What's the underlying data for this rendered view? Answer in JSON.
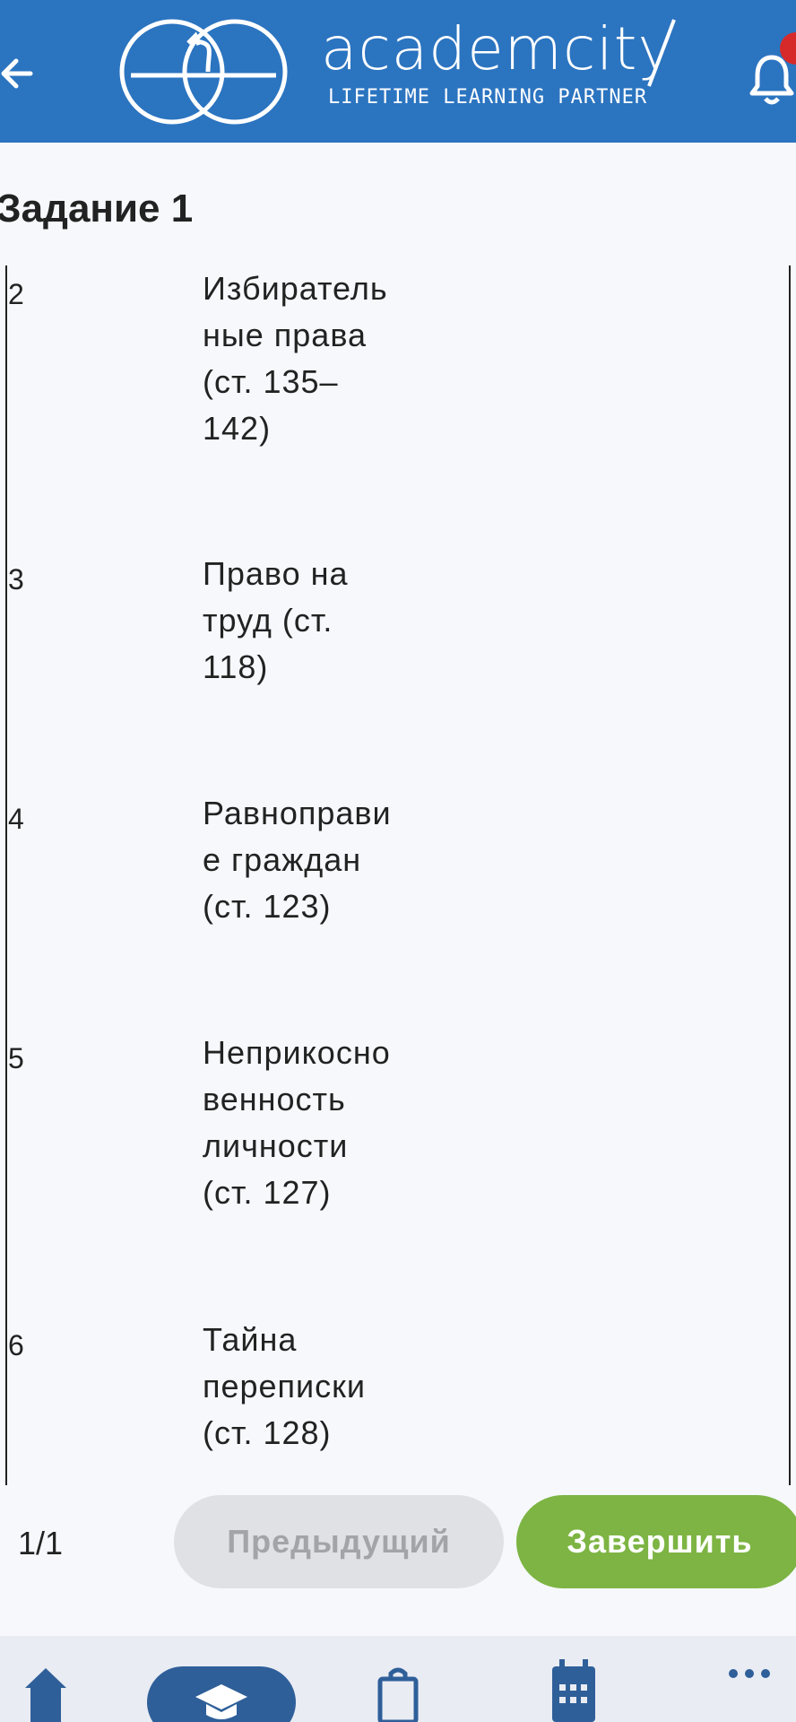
{
  "header": {
    "brand": "academcity",
    "tagline": "LIFETIME LEARNING PARTNER",
    "badge_count": ""
  },
  "task": {
    "title": "Задание 1"
  },
  "rows": [
    {
      "num": "2",
      "text": "Избиратель\nные права\n(ст. 135–\n142)"
    },
    {
      "num": "3",
      "text": "Право на\nтруд (ст.\n118)"
    },
    {
      "num": "4",
      "text": "Равноправи\nе граждан\n(ст. 123)"
    },
    {
      "num": "5",
      "text": "Неприкосно\nвенность\nличности\n(ст. 127)"
    },
    {
      "num": "6",
      "text": "Тайна\nпереписки\n(ст. 128)"
    }
  ],
  "footer": {
    "pager": "1/1",
    "prev_label": "Предыдущий",
    "finish_label": "Завершить"
  },
  "nav": {
    "items": [
      "home-icon",
      "graduation-cap-icon",
      "shopping-bag-icon",
      "calendar-icon",
      "more-icon"
    ],
    "active": "graduation-cap-icon"
  },
  "colors": {
    "header": "#2b74c0",
    "finish": "#7db443",
    "prev": "#e0e1e5",
    "nav_active": "#2f5f99"
  }
}
